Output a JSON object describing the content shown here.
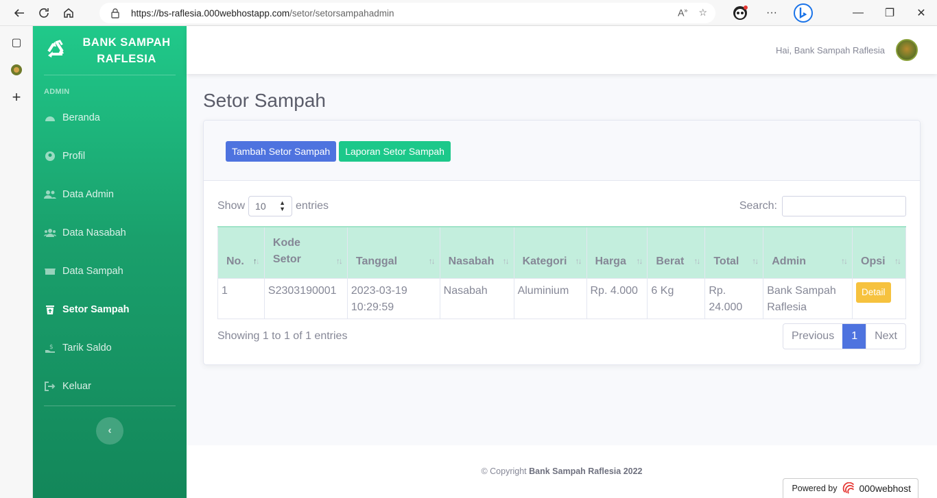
{
  "browser": {
    "url_host": "https://bs-raflesia.000webhostapp.com",
    "url_path": "/setor/setorsampahadmin"
  },
  "brand": {
    "line1": "BANK SAMPAH",
    "line2": "RAFLESIA"
  },
  "sidebar": {
    "heading": "ADMIN",
    "items": [
      {
        "label": "Beranda",
        "icon": "dashboard-icon"
      },
      {
        "label": "Profil",
        "icon": "user-circle-icon"
      },
      {
        "label": "Data Admin",
        "icon": "users-icon"
      },
      {
        "label": "Data Nasabah",
        "icon": "users-group-icon"
      },
      {
        "label": "Data Sampah",
        "icon": "dumpster-icon"
      },
      {
        "label": "Setor Sampah",
        "icon": "trash-upload-icon"
      },
      {
        "label": "Tarik Saldo",
        "icon": "hand-money-icon"
      },
      {
        "label": "Keluar",
        "icon": "logout-icon"
      }
    ],
    "active_index": 5
  },
  "topnav": {
    "greeting": "Hai, Bank Sampah Raflesia"
  },
  "page": {
    "title": "Setor Sampah"
  },
  "actions": {
    "add_label": "Tambah Setor Sampah",
    "report_label": "Laporan Setor Sampah"
  },
  "datatable": {
    "show_label": "Show",
    "length_value": "10",
    "entries_label": "entries",
    "search_label": "Search:",
    "columns": [
      "No.",
      "Kode Setor",
      "Tanggal",
      "Nasabah",
      "Kategori",
      "Harga",
      "Berat",
      "Total",
      "Admin",
      "Opsi"
    ],
    "rows": [
      {
        "no": "1",
        "kode": "S2303190001",
        "tanggal": "2023-03-19 10:29:59",
        "nasabah": "Nasabah",
        "kategori": "Aluminium",
        "harga": "Rp. 4.000",
        "berat": "6 Kg",
        "total": "Rp. 24.000",
        "admin": "Bank Sampah Raflesia",
        "opsi_label": "Detail"
      }
    ],
    "info": "Showing 1 to 1 of 1 entries",
    "pagination": {
      "previous": "Previous",
      "current": "1",
      "next": "Next"
    }
  },
  "footer": {
    "prefix": "© Copyright",
    "owner": "Bank Sampah Raflesia 2022"
  },
  "powered": {
    "label": "Powered by",
    "brand": "000webhost"
  },
  "colors": {
    "sidebar_top": "#20c98a",
    "sidebar_bottom": "#13875a",
    "primary": "#4e73df",
    "success": "#1cc88a",
    "warning": "#f6c23e",
    "table_header": "#c3eedd"
  }
}
